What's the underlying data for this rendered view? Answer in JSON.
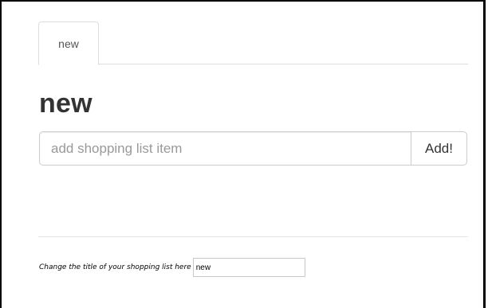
{
  "tabs": [
    {
      "label": "new"
    }
  ],
  "list": {
    "title": "new"
  },
  "add_item": {
    "placeholder": "add shopping list item",
    "value": "",
    "button_label": "Add!"
  },
  "rename": {
    "label": "Change the title of your shopping list here",
    "value": "new"
  }
}
